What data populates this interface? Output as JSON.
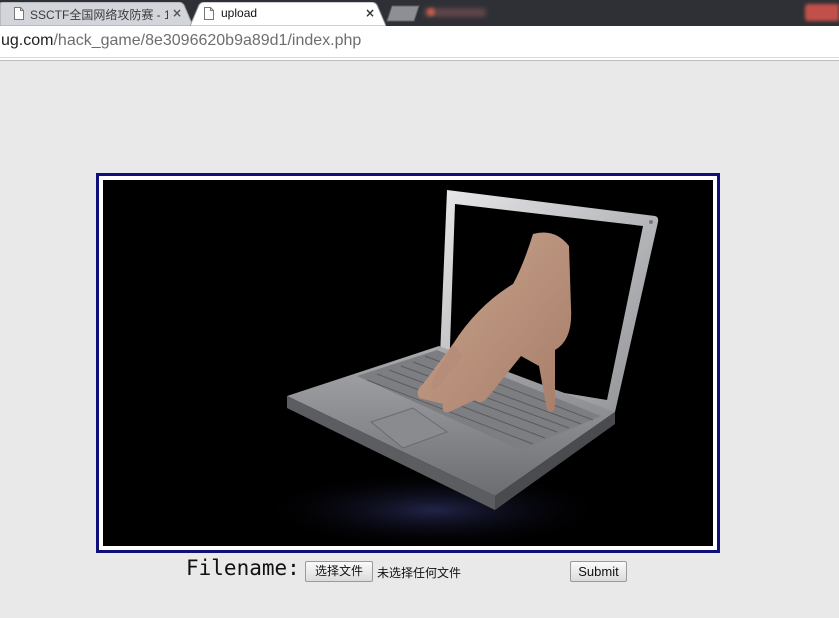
{
  "browser": {
    "tabs": [
      {
        "title": "SSCTF全国网络攻防赛 - 1",
        "active": false,
        "close": "×"
      },
      {
        "title": "upload",
        "active": true,
        "close": "×"
      }
    ],
    "address": {
      "host": "ug.com",
      "path": "/hack_game/8e3096620b9a89d1/index.php"
    }
  },
  "page": {
    "image": {
      "alt": "laptop-with-hand-reaching-out-of-screen"
    },
    "form": {
      "filename_label": "Filename:",
      "file_button_label": "选择文件",
      "file_status": "未选择任何文件",
      "submit_label": "Submit"
    }
  },
  "colors": {
    "tabstrip": "#2f3036",
    "page_background": "#e9e9e9",
    "image_border": "#10107a"
  }
}
